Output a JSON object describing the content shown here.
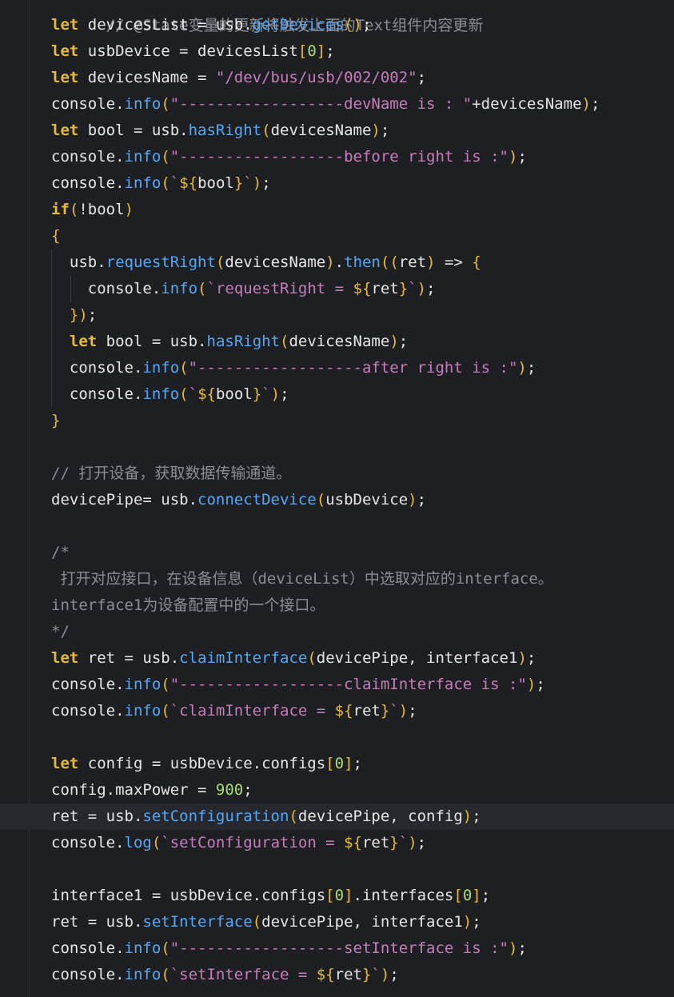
{
  "editor": {
    "header_comment": "// @State变量的更新将触发上面的Text组件内容更新",
    "lines": [
      [
        [
          "kw",
          "let"
        ],
        [
          "id",
          " devicesList = usb."
        ],
        [
          "fn",
          "getDevices"
        ],
        [
          "br",
          "()"
        ],
        [
          "id",
          ";"
        ]
      ],
      [
        [
          "kw",
          "let"
        ],
        [
          "id",
          " usbDevice = devicesList"
        ],
        [
          "br",
          "["
        ],
        [
          "num",
          "0"
        ],
        [
          "br",
          "]"
        ],
        [
          "id",
          ";"
        ]
      ],
      [
        [
          "kw",
          "let"
        ],
        [
          "id",
          " devicesName = "
        ],
        [
          "str",
          "\"/dev/bus/usb/002/002\""
        ],
        [
          "id",
          ";"
        ]
      ],
      [
        [
          "id",
          "console."
        ],
        [
          "fn",
          "info"
        ],
        [
          "br",
          "("
        ],
        [
          "str",
          "\"------------------devName is : \""
        ],
        [
          "id",
          "+devicesName"
        ],
        [
          "br",
          ")"
        ],
        [
          "id",
          ";"
        ]
      ],
      [
        [
          "kw",
          "let"
        ],
        [
          "id",
          " bool = usb."
        ],
        [
          "fn",
          "hasRight"
        ],
        [
          "br",
          "("
        ],
        [
          "id",
          "devicesName"
        ],
        [
          "br",
          ")"
        ],
        [
          "id",
          ";"
        ]
      ],
      [
        [
          "id",
          "console."
        ],
        [
          "fn",
          "info"
        ],
        [
          "br",
          "("
        ],
        [
          "str",
          "\"------------------before right is :\""
        ],
        [
          "br",
          ")"
        ],
        [
          "id",
          ";"
        ]
      ],
      [
        [
          "id",
          "console."
        ],
        [
          "fn",
          "info"
        ],
        [
          "br",
          "("
        ],
        [
          "str",
          "`"
        ],
        [
          "tpl",
          "${"
        ],
        [
          "id",
          "bool"
        ],
        [
          "tpl",
          "}"
        ],
        [
          "str",
          "`"
        ],
        [
          "br",
          ")"
        ],
        [
          "id",
          ";"
        ]
      ],
      [
        [
          "kw",
          "if"
        ],
        [
          "br",
          "("
        ],
        [
          "id",
          "!bool"
        ],
        [
          "br",
          ")"
        ]
      ],
      [
        [
          "br",
          "{"
        ]
      ],
      [
        [
          "id",
          "  usb."
        ],
        [
          "fn",
          "requestRight"
        ],
        [
          "br",
          "("
        ],
        [
          "id",
          "devicesName"
        ],
        [
          "br",
          ")"
        ],
        [
          "id",
          "."
        ],
        [
          "fn",
          "then"
        ],
        [
          "br",
          "(("
        ],
        [
          "id",
          "ret"
        ],
        [
          "br",
          ")"
        ],
        [
          "id",
          " => "
        ],
        [
          "br",
          "{"
        ]
      ],
      [
        [
          "id",
          "    console."
        ],
        [
          "fn",
          "info"
        ],
        [
          "br",
          "("
        ],
        [
          "str",
          "`requestRight = "
        ],
        [
          "tpl",
          "${"
        ],
        [
          "id",
          "ret"
        ],
        [
          "tpl",
          "}"
        ],
        [
          "str",
          "`"
        ],
        [
          "br",
          ")"
        ],
        [
          "id",
          ";"
        ]
      ],
      [
        [
          "id",
          "  "
        ],
        [
          "br",
          "})"
        ],
        [
          "id",
          ";"
        ]
      ],
      [
        [
          "id",
          "  "
        ],
        [
          "kw",
          "let"
        ],
        [
          "id",
          " bool = usb."
        ],
        [
          "fn",
          "hasRight"
        ],
        [
          "br",
          "("
        ],
        [
          "id",
          "devicesName"
        ],
        [
          "br",
          ")"
        ],
        [
          "id",
          ";"
        ]
      ],
      [
        [
          "id",
          "  console."
        ],
        [
          "fn",
          "info"
        ],
        [
          "br",
          "("
        ],
        [
          "str",
          "\"------------------after right is :\""
        ],
        [
          "br",
          ")"
        ],
        [
          "id",
          ";"
        ]
      ],
      [
        [
          "id",
          "  console."
        ],
        [
          "fn",
          "info"
        ],
        [
          "br",
          "("
        ],
        [
          "str",
          "`"
        ],
        [
          "tpl",
          "${"
        ],
        [
          "id",
          "bool"
        ],
        [
          "tpl",
          "}"
        ],
        [
          "str",
          "`"
        ],
        [
          "br",
          ")"
        ],
        [
          "id",
          ";"
        ]
      ],
      [
        [
          "br",
          "}"
        ]
      ],
      [],
      [
        [
          "cm",
          "// 打开设备，获取数据传输通道。"
        ]
      ],
      [
        [
          "id",
          "devicePipe= usb."
        ],
        [
          "fn",
          "connectDevice"
        ],
        [
          "br",
          "("
        ],
        [
          "id",
          "usbDevice"
        ],
        [
          "br",
          ")"
        ],
        [
          "id",
          ";"
        ]
      ],
      [],
      [
        [
          "cm",
          "/*"
        ]
      ],
      [
        [
          "cm",
          " 打开对应接口，在设备信息（deviceList）中选取对应的interface。"
        ]
      ],
      [
        [
          "cm",
          "interface1为设备配置中的一个接口。"
        ]
      ],
      [
        [
          "cm",
          "*/"
        ]
      ],
      [
        [
          "kw",
          "let"
        ],
        [
          "id",
          " ret = usb."
        ],
        [
          "fn",
          "claimInterface"
        ],
        [
          "br",
          "("
        ],
        [
          "id",
          "devicePipe, interface1"
        ],
        [
          "br",
          ")"
        ],
        [
          "id",
          ";"
        ]
      ],
      [
        [
          "id",
          "console."
        ],
        [
          "fn",
          "info"
        ],
        [
          "br",
          "("
        ],
        [
          "str",
          "\"------------------claimInterface is :\""
        ],
        [
          "br",
          ")"
        ],
        [
          "id",
          ";"
        ]
      ],
      [
        [
          "id",
          "console."
        ],
        [
          "fn",
          "info"
        ],
        [
          "br",
          "("
        ],
        [
          "str",
          "`claimInterface = "
        ],
        [
          "tpl",
          "${"
        ],
        [
          "id",
          "ret"
        ],
        [
          "tpl",
          "}"
        ],
        [
          "str",
          "`"
        ],
        [
          "br",
          ")"
        ],
        [
          "id",
          ";"
        ]
      ],
      [],
      [
        [
          "kw",
          "let"
        ],
        [
          "id",
          " config = usbDevice.configs"
        ],
        [
          "br",
          "["
        ],
        [
          "num",
          "0"
        ],
        [
          "br",
          "]"
        ],
        [
          "id",
          ";"
        ]
      ],
      [
        [
          "id",
          "config.maxPower = "
        ],
        [
          "num",
          "900"
        ],
        [
          "id",
          ";"
        ]
      ],
      [
        [
          "id",
          "ret = usb."
        ],
        [
          "fn",
          "setConfiguration"
        ],
        [
          "br",
          "("
        ],
        [
          "id",
          "devicePipe, config"
        ],
        [
          "br",
          ")"
        ],
        [
          "id",
          ";"
        ]
      ],
      [
        [
          "id",
          "console."
        ],
        [
          "fn",
          "log"
        ],
        [
          "br",
          "("
        ],
        [
          "str",
          "`setConfiguration = "
        ],
        [
          "tpl",
          "${"
        ],
        [
          "id",
          "ret"
        ],
        [
          "tpl",
          "}"
        ],
        [
          "str",
          "`"
        ],
        [
          "br",
          ")"
        ],
        [
          "id",
          ";"
        ]
      ],
      [],
      [
        [
          "id",
          "interface1 = usbDevice.configs"
        ],
        [
          "br",
          "["
        ],
        [
          "num",
          "0"
        ],
        [
          "br",
          "]"
        ],
        [
          "id",
          ".interfaces"
        ],
        [
          "br",
          "["
        ],
        [
          "num",
          "0"
        ],
        [
          "br",
          "]"
        ],
        [
          "id",
          ";"
        ]
      ],
      [
        [
          "id",
          "ret = usb."
        ],
        [
          "fn",
          "setInterface"
        ],
        [
          "br",
          "("
        ],
        [
          "id",
          "devicePipe, interface1"
        ],
        [
          "br",
          ")"
        ],
        [
          "id",
          ";"
        ]
      ],
      [
        [
          "id",
          "console."
        ],
        [
          "fn",
          "info"
        ],
        [
          "br",
          "("
        ],
        [
          "str",
          "\"------------------setInterface is :\""
        ],
        [
          "br",
          ")"
        ],
        [
          "id",
          ";"
        ]
      ],
      [
        [
          "id",
          "console."
        ],
        [
          "fn",
          "info"
        ],
        [
          "br",
          "("
        ],
        [
          "str",
          "`setInterface = "
        ],
        [
          "tpl",
          "${"
        ],
        [
          "id",
          "ret"
        ],
        [
          "tpl",
          "}"
        ],
        [
          "str",
          "`"
        ],
        [
          "br",
          ")"
        ],
        [
          "id",
          ";"
        ]
      ]
    ]
  }
}
